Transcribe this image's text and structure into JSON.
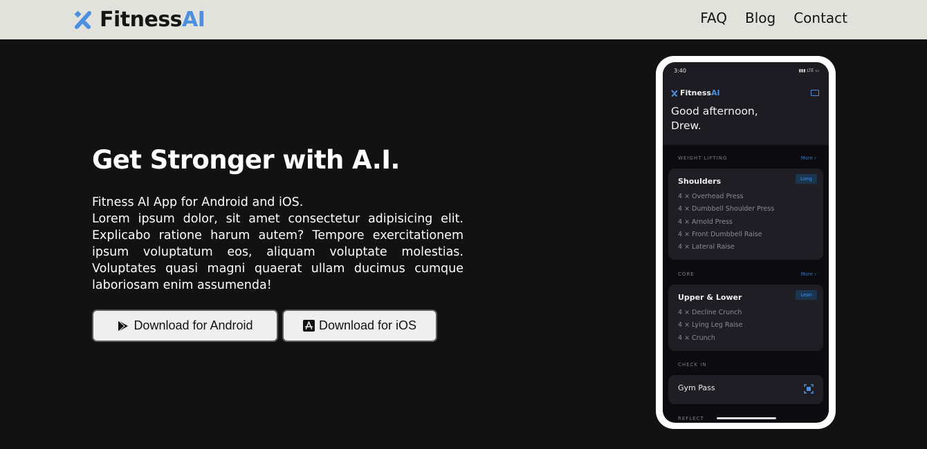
{
  "navbar": {
    "brand_main": "Fitness",
    "brand_accent": "AI",
    "links": [
      "FAQ",
      "Blog",
      "Contact"
    ]
  },
  "hero": {
    "title": "Get Stronger with A.I.",
    "subtitle": "Fitness AI App for Android and iOS.",
    "body": "Lorem ipsum dolor, sit amet consectetur adipisicing elit. Explicabo ratione harum autem? Tempore exercitationem ipsum voluptatum eos, aliquam voluptate molestias. Voluptates quasi magni quaerat ullam ducimus cumque laboriosam enim assumenda!",
    "android_button": "Download for Android",
    "ios_button": "Download for iOS"
  },
  "phone": {
    "time": "3:40",
    "network": "LTE",
    "app_name_main": "Fitness",
    "app_name_accent": "AI",
    "greeting": "Good afternoon, Drew.",
    "sections": [
      {
        "label": "WEIGHT LIFTING",
        "more": "More",
        "card_title": "Shoulders",
        "badge": "Long",
        "exercises": [
          "4 × Overhead Press",
          "4 × Dumbbell Shoulder Press",
          "4 × Arnold Press",
          "4 × Front Dumbbell Raise",
          "4 × Lateral Raise"
        ]
      },
      {
        "label": "CORE",
        "more": "More",
        "card_title": "Upper & Lower",
        "badge": "Lean",
        "exercises": [
          "4 × Decline Crunch",
          "4 × Lying Leg Raise",
          "4 × Crunch"
        ]
      }
    ],
    "checkin_label": "CHECK IN",
    "checkin_card": "Gym Pass",
    "reflect_label": "REFLECT"
  },
  "colors": {
    "accent": "#4a8fe0",
    "background": "#121212",
    "navbar": "#e2e2dd"
  },
  "icons": {
    "brand": "fitnessai-logo-icon",
    "android": "google-play-icon",
    "ios": "app-store-icon",
    "scan": "scan-icon"
  }
}
